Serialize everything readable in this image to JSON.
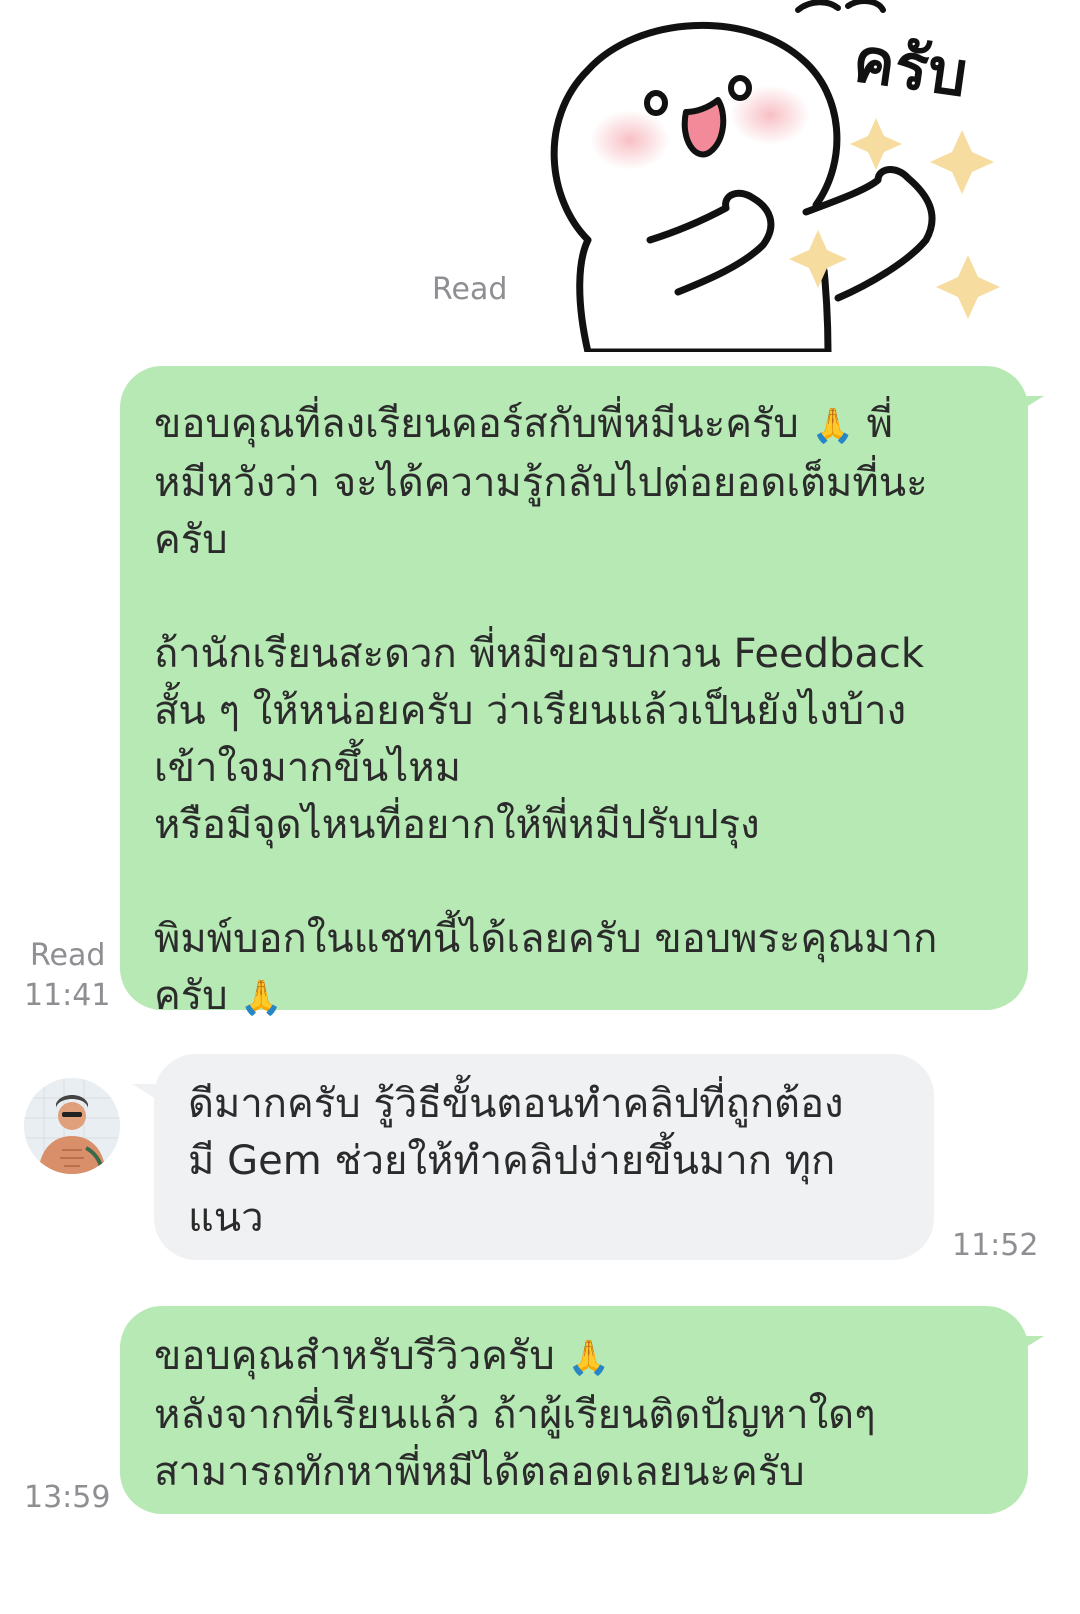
{
  "sticker": {
    "caption": "ครับ",
    "read_label": "Read"
  },
  "messages": [
    {
      "read_label": "Read",
      "time": "11:41",
      "paragraphs": [
        "ขอบคุณที่ลงเรียนคอร์สกับพี่หมีนะครับ",
        "พี่",
        "หมีหวังว่า จะได้ความรู้กลับไปต่อยอดเต็มที่นะ\nครับ",
        "ถ้านักเรียนสะดวก พี่หมีขอรบกวน Feedback\nสั้น ๆ ให้หน่อยครับ ว่าเรียนแล้วเป็นยังไงบ้าง\nเข้าใจมากขึ้นไหม\nหรือมีจุดไหนที่อยากให้พี่หมีปรับปรุง",
        "พิมพ์บอกในแชทนี้ได้เลยครับ ขอบพระคุณมาก",
        "ครับ"
      ],
      "emoji": "🙏"
    },
    {
      "time": "11:52",
      "text": "ดีมากครับ รู้วิธีขั้นตอนทำคลิปที่ถูกต้อง\nมี Gem ช่วยให้ทำคลิปง่ายขึ้นมาก ทุก\nแนว"
    },
    {
      "time": "13:59",
      "line1": "ขอบคุณสำหรับรีวิวครับ",
      "emoji": "🙏",
      "rest": "หลังจากที่เรียนแล้ว ถ้าผู้เรียนติดปัญหาใดๆ\nสามารถทักหาพี่หมีได้ตลอดเลยนะครับ"
    }
  ],
  "colors": {
    "outgoing_bubble": "#b6e9b4",
    "incoming_bubble": "#f0f1f3",
    "meta_text": "#8e8e93"
  }
}
